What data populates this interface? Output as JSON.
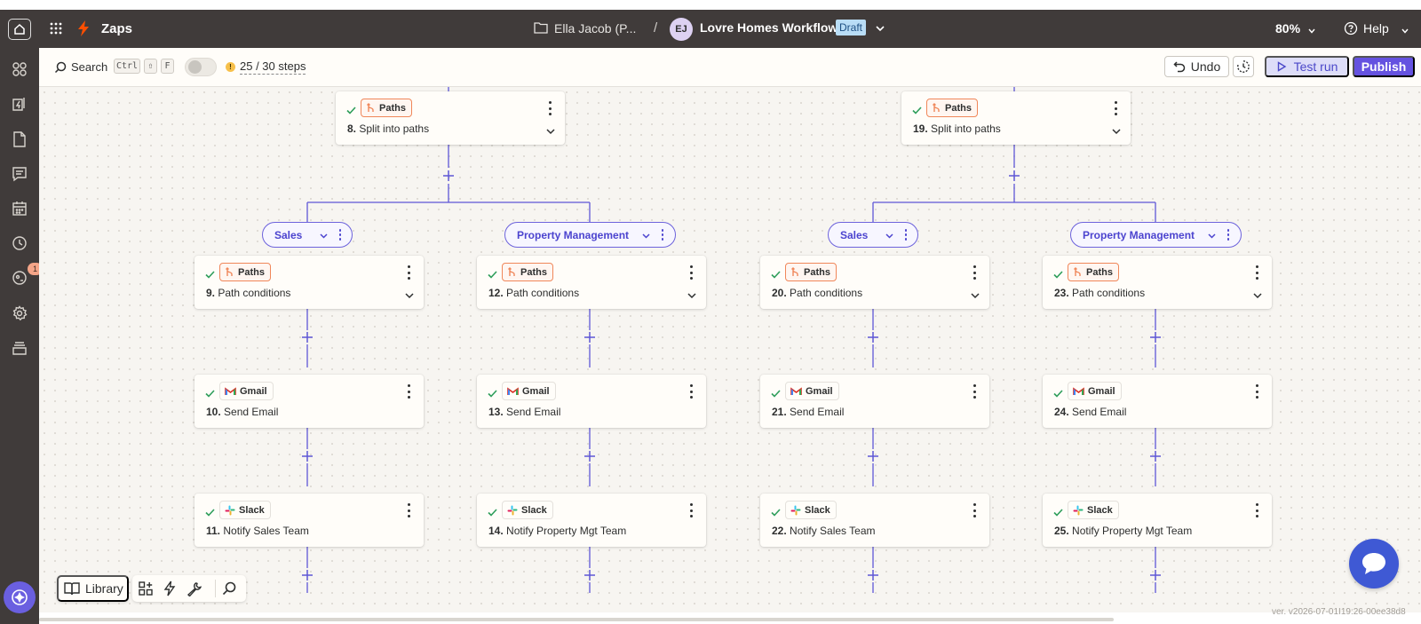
{
  "topbar": {
    "app_name": "Zaps",
    "folder_name": "Ella Jacob (P...",
    "separator": "/",
    "avatar_initials": "EJ",
    "zap_title": "Lovre Homes Workflow",
    "status_badge": "Draft",
    "zoom": "80%",
    "help_label": "Help",
    "icons": [
      "home-icon",
      "apps-grid-icon",
      "zap-bolt-icon",
      "folder-icon",
      "chevron-down-icon",
      "help-circle-icon"
    ],
    "accent": "#ff4f00"
  },
  "sidebar": {
    "items": [
      {
        "name": "apps-icon"
      },
      {
        "name": "zaps-icon"
      },
      {
        "name": "tables-icon"
      },
      {
        "name": "interfaces-icon"
      },
      {
        "name": "calendar-icon"
      },
      {
        "name": "history-icon"
      },
      {
        "name": "notifications-icon",
        "badge": "1"
      },
      {
        "name": "settings-icon"
      },
      {
        "name": "archive-icon"
      }
    ],
    "bottom_icon": "copilot-icon"
  },
  "toolbar": {
    "search_label": "Search",
    "shortcut_keys": [
      "Ctrl",
      "⇧",
      "F"
    ],
    "steps_label": "25 / 30 steps",
    "undo_label": "Undo",
    "test_run_label": "Test run",
    "publish_label": "Publish",
    "colors": {
      "publish": "#6552e0",
      "test_run": "#ddddf8"
    }
  },
  "canvas": {
    "split_steps": [
      {
        "app": "Paths",
        "num": "8.",
        "title": "Split into paths"
      },
      {
        "app": "Paths",
        "num": "19.",
        "title": "Split into paths"
      }
    ],
    "path_pills": [
      {
        "label": "Sales"
      },
      {
        "label": "Property Management"
      },
      {
        "label": "Sales"
      },
      {
        "label": "Property Management"
      }
    ],
    "columns": [
      {
        "steps": [
          {
            "app": "Paths",
            "num": "9.",
            "title": "Path conditions"
          },
          {
            "app": "Gmail",
            "num": "10.",
            "title": "Send Email"
          },
          {
            "app": "Slack",
            "num": "11.",
            "title": "Notify Sales Team"
          }
        ]
      },
      {
        "steps": [
          {
            "app": "Paths",
            "num": "12.",
            "title": "Path conditions"
          },
          {
            "app": "Gmail",
            "num": "13.",
            "title": "Send Email"
          },
          {
            "app": "Slack",
            "num": "14.",
            "title": "Notify Property Mgt Team"
          }
        ]
      },
      {
        "steps": [
          {
            "app": "Paths",
            "num": "20.",
            "title": "Path conditions"
          },
          {
            "app": "Gmail",
            "num": "21.",
            "title": "Send Email"
          },
          {
            "app": "Slack",
            "num": "22.",
            "title": "Notify Sales Team"
          }
        ]
      },
      {
        "steps": [
          {
            "app": "Paths",
            "num": "23.",
            "title": "Path conditions"
          },
          {
            "app": "Gmail",
            "num": "24.",
            "title": "Send Email"
          },
          {
            "app": "Slack",
            "num": "25.",
            "title": "Notify Property Mgt Team"
          }
        ]
      }
    ],
    "line_color": "#5e56d6",
    "paths_color": "#f0875a",
    "check_color": "#2e9e5b"
  },
  "bottom_toolbar": {
    "library_label": "Library",
    "tools": [
      "layout-icon",
      "bolt-icon",
      "wrench-icon",
      "search-icon"
    ]
  },
  "version": "ver. v2026-07-01I19:26-00ee38d8",
  "chat_icon": "chat-bubble-icon"
}
